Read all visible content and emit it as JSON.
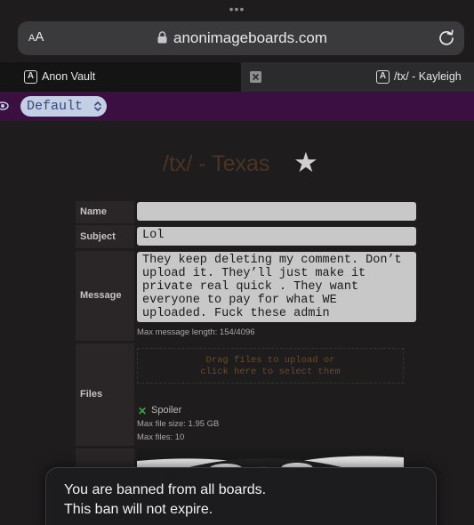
{
  "browser": {
    "grabber": "•••",
    "text_size_button": "AA",
    "url": "anonimageboards.com",
    "tabs": [
      {
        "label": "Anon Vault",
        "icon": "A"
      },
      {
        "label": "/tx/ - Kayleigh",
        "icon": "A"
      }
    ]
  },
  "toolbar": {
    "theme_select": "Default"
  },
  "board": {
    "title": "/tx/ - Texas",
    "favorite_icon": "★"
  },
  "form": {
    "name_label": "Name",
    "name_value": "",
    "subject_label": "Subject",
    "subject_value": "Lol",
    "message_label": "Message",
    "message_value": "They keep deleting my comment. Don’t\nupload it. They’ll just make it\nprivate real quick . They want\neveryone to pay for what WE\nuploaded. Fuck these admin",
    "max_message_length": "Max message length: 154/4096",
    "files_label": "Files",
    "dropzone_text": "Drag files to upload or\nclick here to select them",
    "spoiler_label": "Spoiler",
    "max_file_size": "Max file size: 1.95 GB",
    "max_files": "Max files: 10"
  },
  "toast": {
    "line1": "You are banned from all boards.",
    "line2": "This ban will not expire."
  }
}
